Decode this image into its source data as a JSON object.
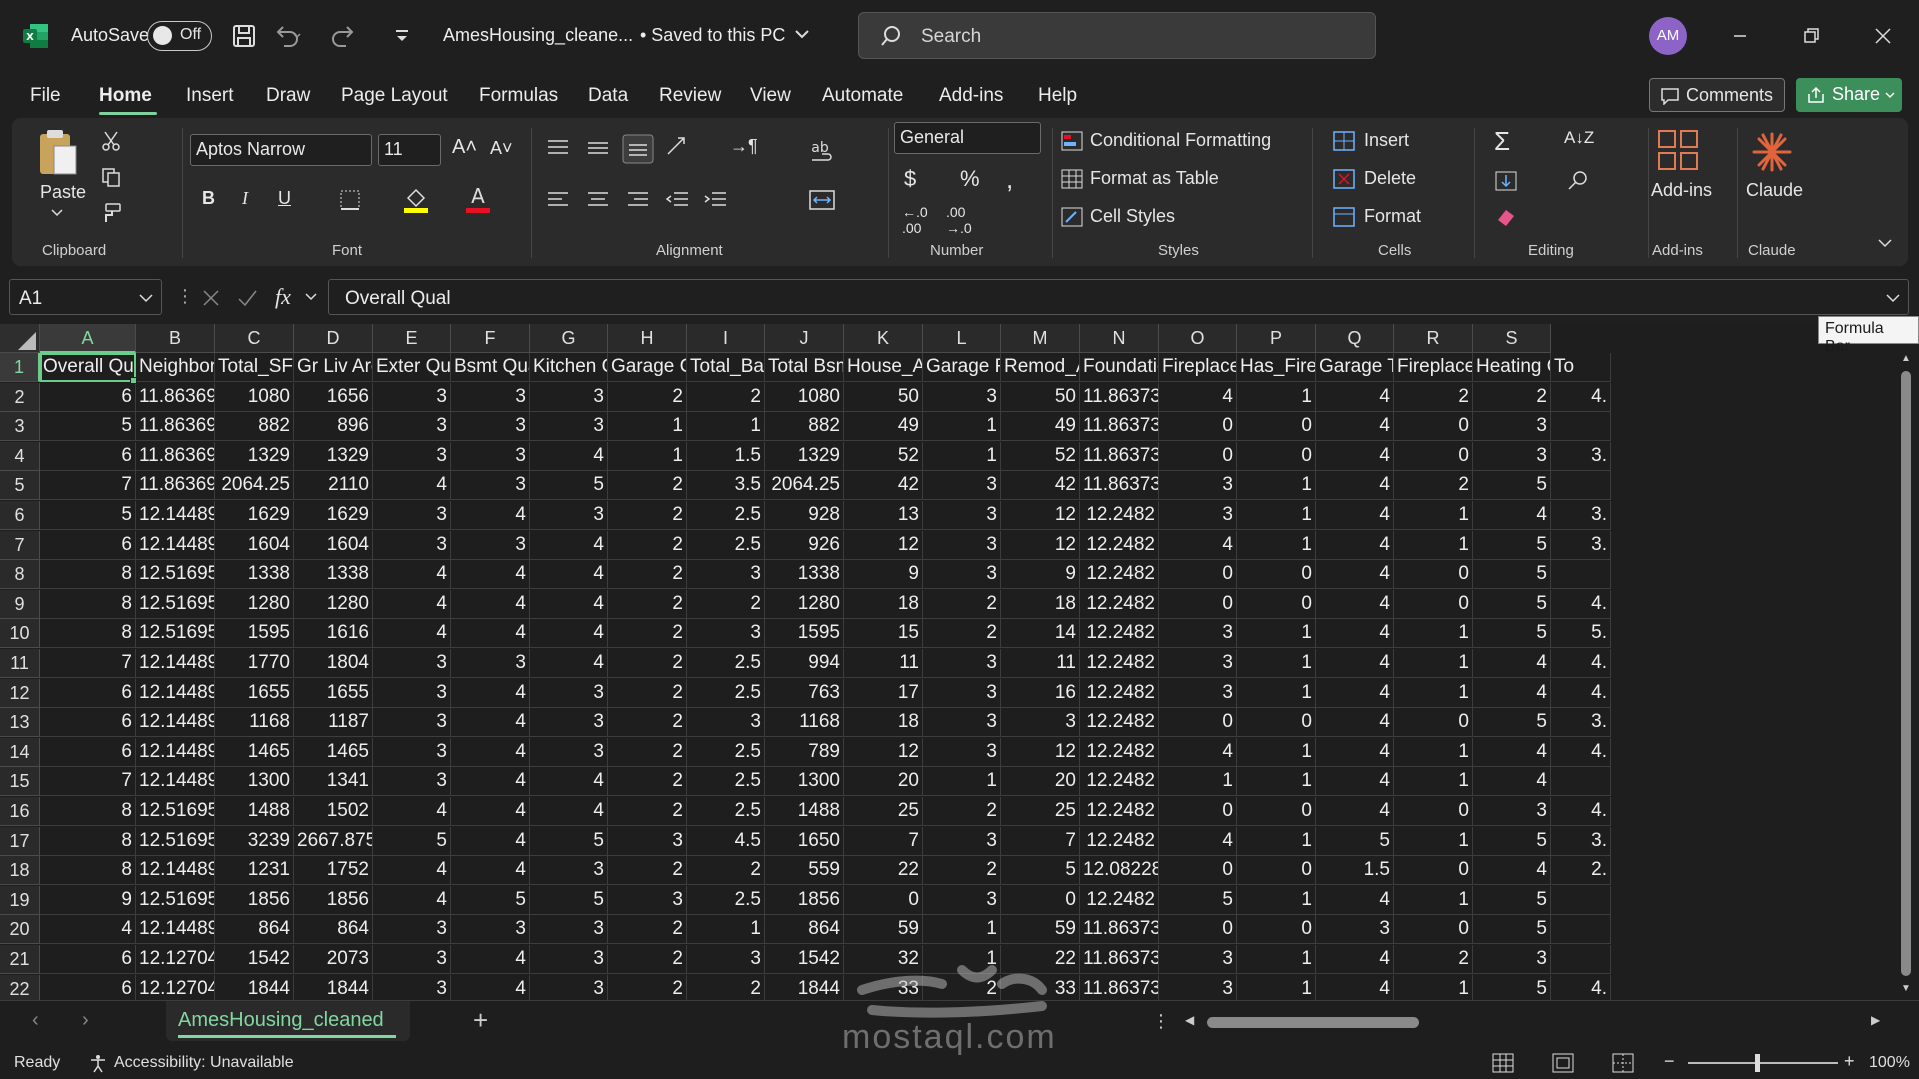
{
  "app": {
    "autosave_label": "AutoSave",
    "autosave_state": "Off",
    "doc_title": "AmesHousing_cleane...",
    "save_status": "• Saved to this PC",
    "search_placeholder": "Search",
    "avatar_initials": "AM",
    "accent_color": "#7fd1a0"
  },
  "menu": {
    "tabs": [
      "File",
      "Home",
      "Insert",
      "Draw",
      "Page Layout",
      "Formulas",
      "Data",
      "Review",
      "View",
      "Automate",
      "Add-ins",
      "Help"
    ],
    "active": "Home",
    "comments_label": "Comments",
    "share_label": "Share"
  },
  "ribbon": {
    "clipboard": {
      "paste": "Paste",
      "label": "Clipboard"
    },
    "font": {
      "name": "Aptos Narrow",
      "size": "11",
      "label": "Font"
    },
    "alignment": {
      "label": "Alignment"
    },
    "number": {
      "format": "General",
      "label": "Number"
    },
    "styles": {
      "conditional": "Conditional Formatting",
      "table": "Format as Table",
      "cell": "Cell Styles",
      "label": "Styles"
    },
    "cells": {
      "insert": "Insert",
      "delete": "Delete",
      "format": "Format",
      "label": "Cells"
    },
    "editing": {
      "label": "Editing"
    },
    "addins": {
      "btn": "Add-ins",
      "label": "Add-ins"
    },
    "claude": {
      "btn": "Claude",
      "label": "Claude"
    }
  },
  "formula_bar": {
    "cell_ref": "A1",
    "fx": "fx",
    "content": "Overall Qual",
    "tooltip": "Formula Bar"
  },
  "sheet": {
    "columns": [
      "A",
      "B",
      "C",
      "D",
      "E",
      "F",
      "G",
      "H",
      "I",
      "J",
      "K",
      "L",
      "M",
      "N",
      "O",
      "P",
      "Q",
      "R",
      "S"
    ],
    "header_row": [
      "Overall Qu",
      "Neighborh",
      "Total_SF",
      "Gr Liv Area",
      "Exter Qual",
      "Bsmt Qual",
      "Kitchen Qu",
      "Garage Ca",
      "Total_Bath",
      "Total Bsmt",
      "House_Ag",
      "Garage Fir",
      "Remod_Ag",
      "Foundatio",
      "Fireplace (",
      "Has_Firepl",
      "Garage Typ",
      "Fireplaces",
      "Heating Q(",
      "To"
    ],
    "rows": [
      [
        "6",
        "11.86369",
        "1080",
        "1656",
        "3",
        "3",
        "3",
        "2",
        "2",
        "1080",
        "50",
        "3",
        "50",
        "11.86373",
        "4",
        "1",
        "4",
        "2",
        "2",
        "4."
      ],
      [
        "5",
        "11.86369",
        "882",
        "896",
        "3",
        "3",
        "3",
        "1",
        "1",
        "882",
        "49",
        "1",
        "49",
        "11.86373",
        "0",
        "0",
        "4",
        "0",
        "3",
        ""
      ],
      [
        "6",
        "11.86369",
        "1329",
        "1329",
        "3",
        "3",
        "4",
        "1",
        "1.5",
        "1329",
        "52",
        "1",
        "52",
        "11.86373",
        "0",
        "0",
        "4",
        "0",
        "3",
        "3."
      ],
      [
        "7",
        "11.86369",
        "2064.25",
        "2110",
        "4",
        "3",
        "5",
        "2",
        "3.5",
        "2064.25",
        "42",
        "3",
        "42",
        "11.86373",
        "3",
        "1",
        "4",
        "2",
        "5",
        ""
      ],
      [
        "5",
        "12.14489",
        "1629",
        "1629",
        "3",
        "4",
        "3",
        "2",
        "2.5",
        "928",
        "13",
        "3",
        "12",
        "12.2482",
        "3",
        "1",
        "4",
        "1",
        "4",
        "3."
      ],
      [
        "6",
        "12.14489",
        "1604",
        "1604",
        "3",
        "3",
        "4",
        "2",
        "2.5",
        "926",
        "12",
        "3",
        "12",
        "12.2482",
        "4",
        "1",
        "4",
        "1",
        "5",
        "3."
      ],
      [
        "8",
        "12.51695",
        "1338",
        "1338",
        "4",
        "4",
        "4",
        "2",
        "3",
        "1338",
        "9",
        "3",
        "9",
        "12.2482",
        "0",
        "0",
        "4",
        "0",
        "5",
        ""
      ],
      [
        "8",
        "12.51695",
        "1280",
        "1280",
        "4",
        "4",
        "4",
        "2",
        "2",
        "1280",
        "18",
        "2",
        "18",
        "12.2482",
        "0",
        "0",
        "4",
        "0",
        "5",
        "4."
      ],
      [
        "8",
        "12.51695",
        "1595",
        "1616",
        "4",
        "4",
        "4",
        "2",
        "3",
        "1595",
        "15",
        "2",
        "14",
        "12.2482",
        "3",
        "1",
        "4",
        "1",
        "5",
        "5."
      ],
      [
        "7",
        "12.14489",
        "1770",
        "1804",
        "3",
        "3",
        "4",
        "2",
        "2.5",
        "994",
        "11",
        "3",
        "11",
        "12.2482",
        "3",
        "1",
        "4",
        "1",
        "4",
        "4."
      ],
      [
        "6",
        "12.14489",
        "1655",
        "1655",
        "3",
        "4",
        "3",
        "2",
        "2.5",
        "763",
        "17",
        "3",
        "16",
        "12.2482",
        "3",
        "1",
        "4",
        "1",
        "4",
        "4."
      ],
      [
        "6",
        "12.14489",
        "1168",
        "1187",
        "3",
        "4",
        "3",
        "2",
        "3",
        "1168",
        "18",
        "3",
        "3",
        "12.2482",
        "0",
        "0",
        "4",
        "0",
        "5",
        "3."
      ],
      [
        "6",
        "12.14489",
        "1465",
        "1465",
        "3",
        "4",
        "3",
        "2",
        "2.5",
        "789",
        "12",
        "3",
        "12",
        "12.2482",
        "4",
        "1",
        "4",
        "1",
        "4",
        "4."
      ],
      [
        "7",
        "12.14489",
        "1300",
        "1341",
        "3",
        "4",
        "4",
        "2",
        "2.5",
        "1300",
        "20",
        "1",
        "20",
        "12.2482",
        "1",
        "1",
        "4",
        "1",
        "4",
        ""
      ],
      [
        "8",
        "12.51695",
        "1488",
        "1502",
        "4",
        "4",
        "4",
        "2",
        "2.5",
        "1488",
        "25",
        "2",
        "25",
        "12.2482",
        "0",
        "0",
        "4",
        "0",
        "3",
        "4."
      ],
      [
        "8",
        "12.51695",
        "3239",
        "2667.875",
        "5",
        "4",
        "5",
        "3",
        "4.5",
        "1650",
        "7",
        "3",
        "7",
        "12.2482",
        "4",
        "1",
        "5",
        "1",
        "5",
        "3."
      ],
      [
        "8",
        "12.14489",
        "1231",
        "1752",
        "4",
        "4",
        "3",
        "2",
        "2",
        "559",
        "22",
        "2",
        "5",
        "12.08228",
        "0",
        "0",
        "1.5",
        "0",
        "4",
        "2."
      ],
      [
        "9",
        "12.51695",
        "1856",
        "1856",
        "4",
        "5",
        "5",
        "3",
        "2.5",
        "1856",
        "0",
        "3",
        "0",
        "12.2482",
        "5",
        "1",
        "4",
        "1",
        "5",
        ""
      ],
      [
        "4",
        "12.14489",
        "864",
        "864",
        "3",
        "3",
        "3",
        "2",
        "1",
        "864",
        "59",
        "1",
        "59",
        "11.86373",
        "0",
        "0",
        "3",
        "0",
        "5",
        ""
      ],
      [
        "6",
        "12.12704",
        "1542",
        "2073",
        "3",
        "4",
        "3",
        "2",
        "3",
        "1542",
        "32",
        "1",
        "22",
        "11.86373",
        "3",
        "1",
        "4",
        "2",
        "3",
        ""
      ],
      [
        "6",
        "12.12704",
        "1844",
        "1844",
        "3",
        "4",
        "3",
        "2",
        "2",
        "1844",
        "33",
        "2",
        "33",
        "11.86373",
        "3",
        "1",
        "4",
        "1",
        "5",
        "4."
      ]
    ]
  },
  "sheet_tab": {
    "name": "AmesHousing_cleaned",
    "add": "+"
  },
  "status": {
    "ready": "Ready",
    "accessibility": "Accessibility: Unavailable",
    "zoom": "100%"
  },
  "watermark": {
    "text": "mostaql.com"
  }
}
